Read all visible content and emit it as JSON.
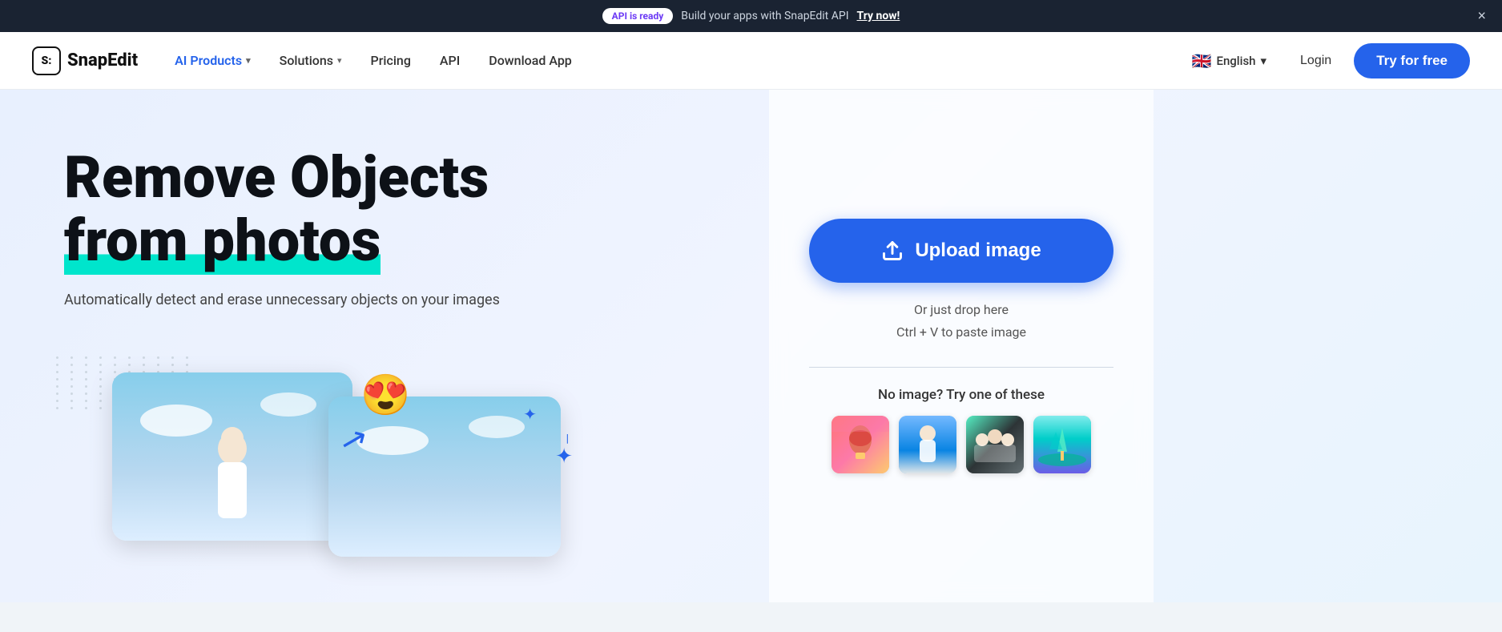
{
  "banner": {
    "badge_text": "API is ready",
    "text": "Build your apps with SnapEdit API",
    "link_text": "Try now!",
    "close_label": "×"
  },
  "navbar": {
    "logo_text": "SnapEdit",
    "logo_icon": "S:",
    "nav_items": [
      {
        "id": "ai-products",
        "label": "AI Products",
        "has_dropdown": true,
        "active": true
      },
      {
        "id": "solutions",
        "label": "Solutions",
        "has_dropdown": true,
        "active": false
      },
      {
        "id": "pricing",
        "label": "Pricing",
        "has_dropdown": false,
        "active": false
      },
      {
        "id": "api",
        "label": "API",
        "has_dropdown": false,
        "active": false
      },
      {
        "id": "download-app",
        "label": "Download App",
        "has_dropdown": false,
        "active": false
      }
    ],
    "language": {
      "flag": "🇬🇧",
      "label": "English",
      "has_dropdown": true
    },
    "login_label": "Login",
    "try_label": "Try for free"
  },
  "hero": {
    "title_line1": "Remove Objects",
    "title_line2": "from photos",
    "subtitle": "Automatically detect and erase unnecessary objects on your images",
    "upload_button_label": "Upload image",
    "drop_hint_line1": "Or just drop here",
    "drop_hint_line2": "Ctrl + V to paste image",
    "sample_label": "No image? Try one of these",
    "sample_images": [
      {
        "id": 1,
        "alt": "Hot air balloons"
      },
      {
        "id": 2,
        "alt": "Person at beach"
      },
      {
        "id": 3,
        "alt": "Group photo"
      },
      {
        "id": 4,
        "alt": "Tropical landscape"
      }
    ]
  },
  "demo": {
    "emoji": "😍",
    "arrow": "↘",
    "sparkle": "✦"
  }
}
